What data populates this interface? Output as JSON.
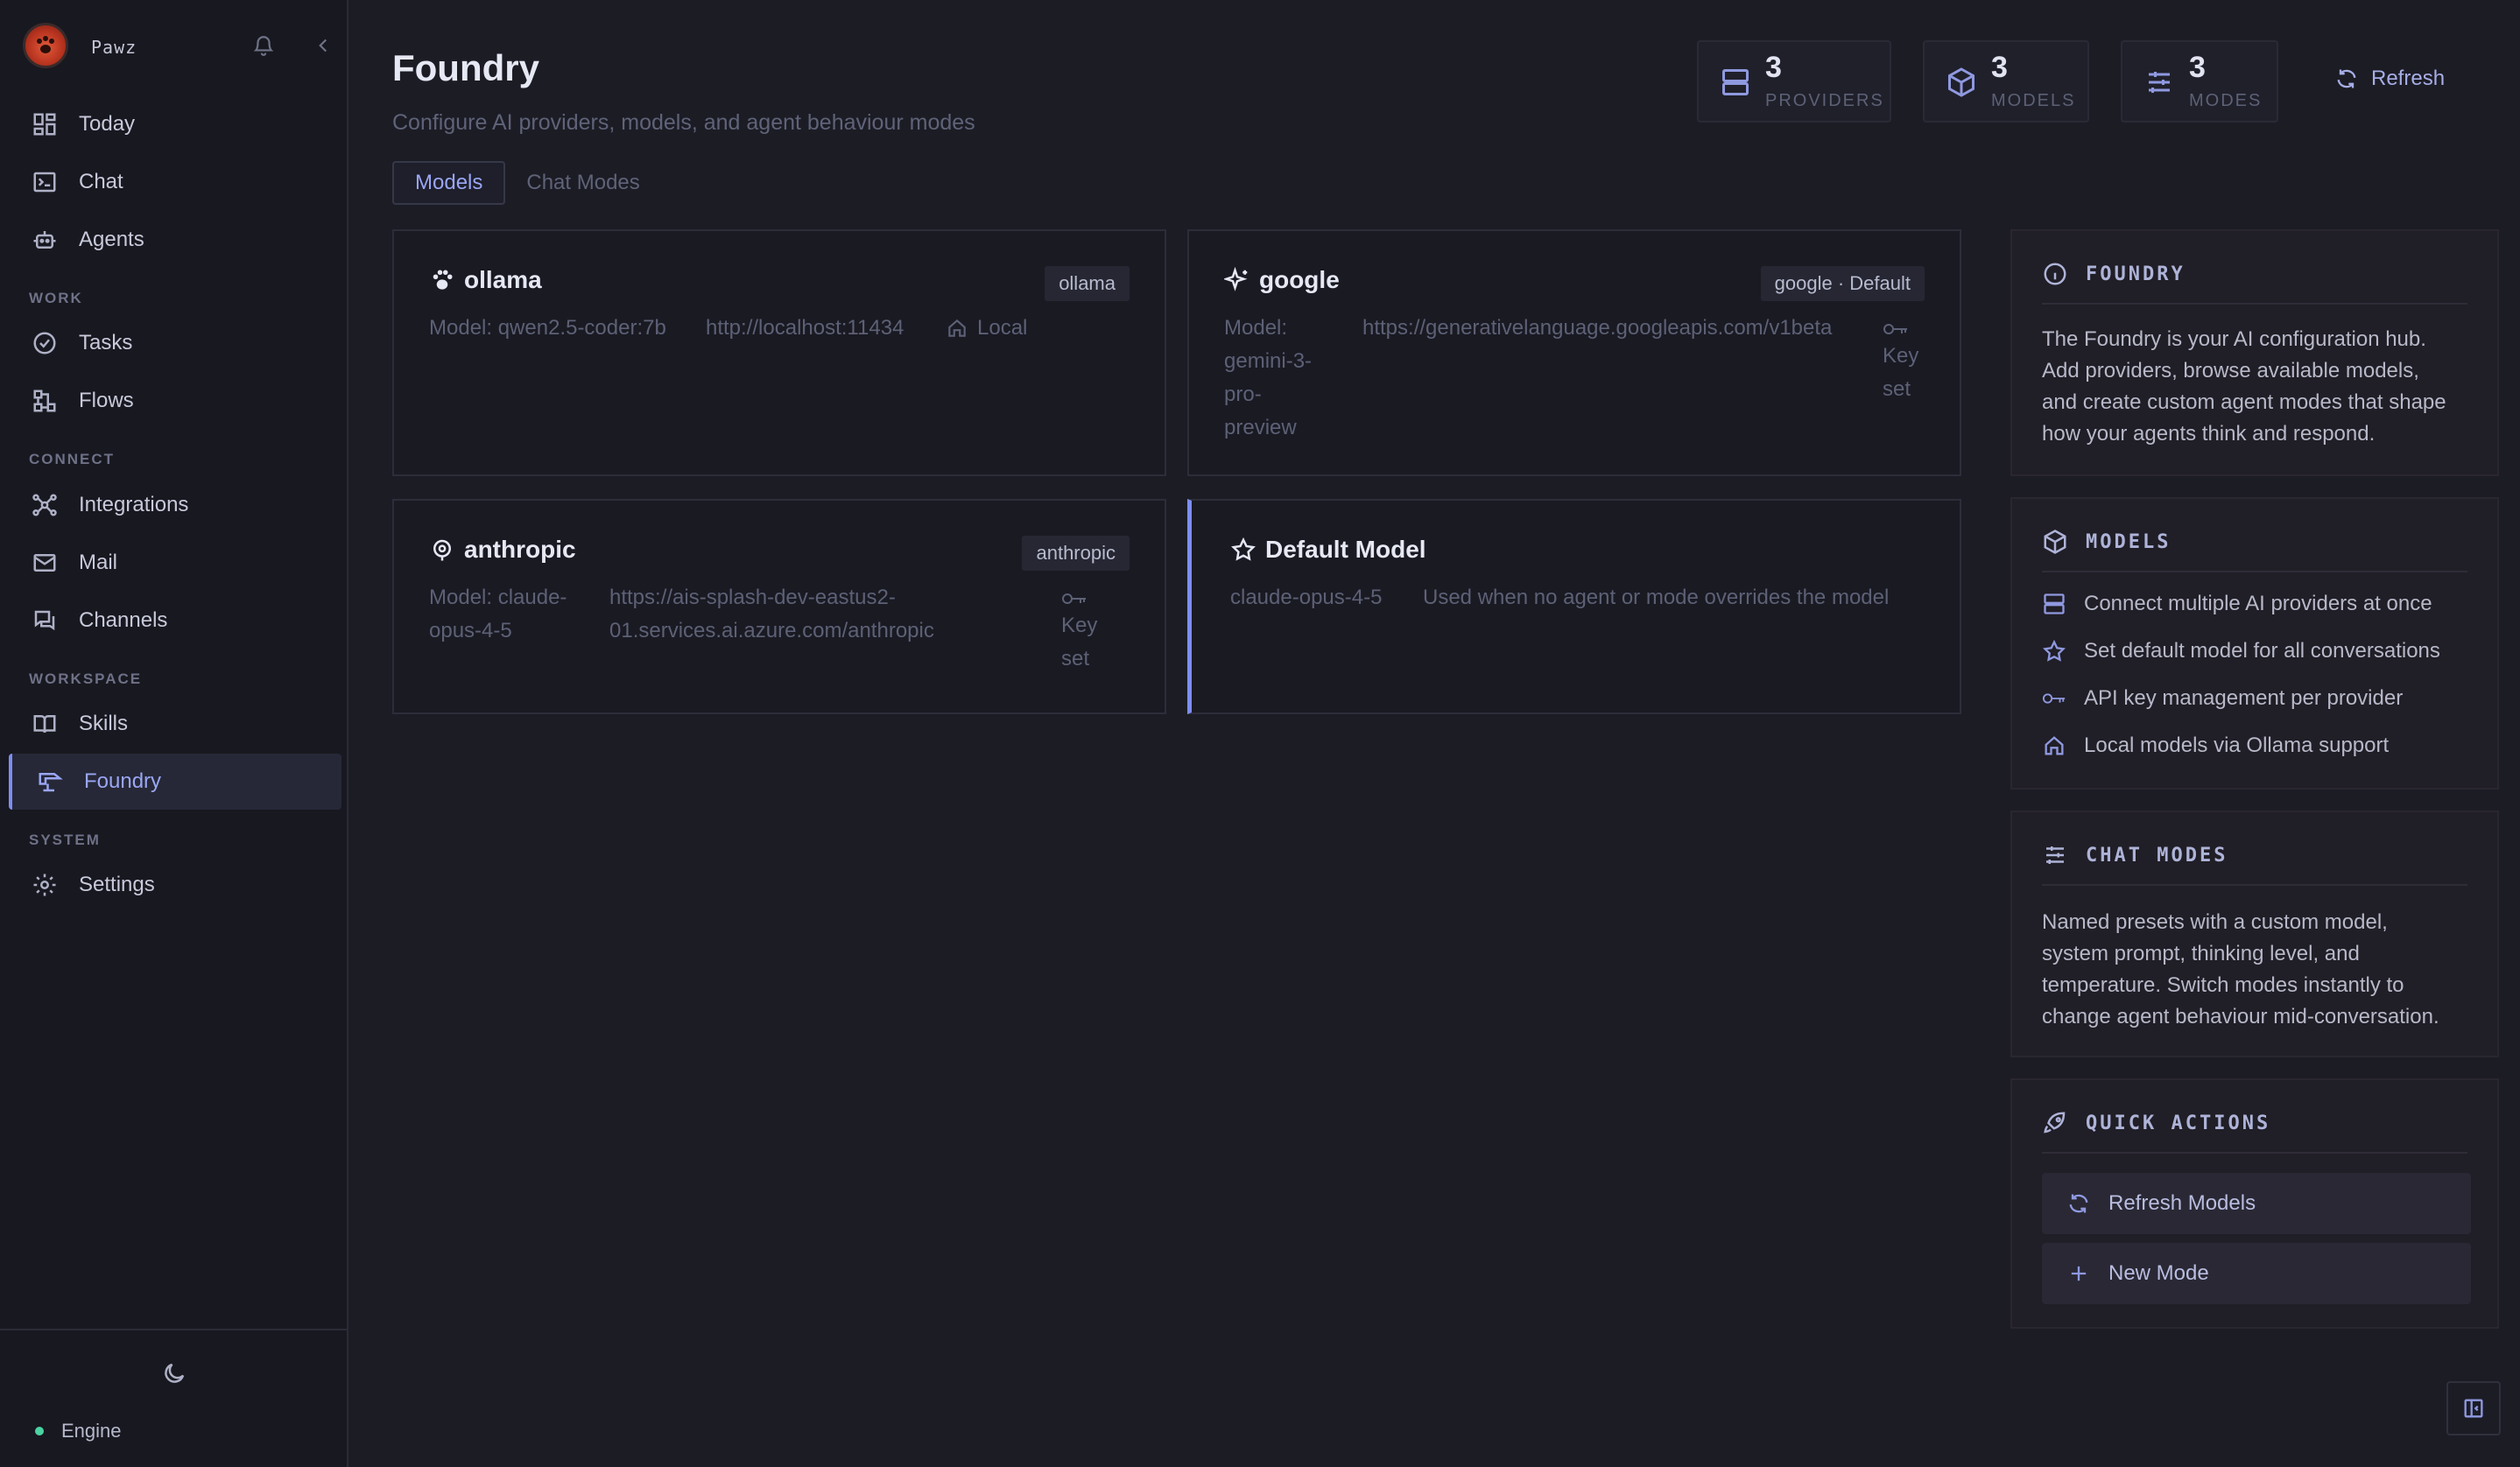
{
  "brand": {
    "name": "Pawz"
  },
  "sidebar": {
    "items_top": [
      {
        "label": "Today"
      },
      {
        "label": "Chat"
      },
      {
        "label": "Agents"
      }
    ],
    "sections": {
      "work": "WORK",
      "connect": "CONNECT",
      "workspace": "WORKSPACE",
      "system": "SYSTEM"
    },
    "work_items": [
      {
        "label": "Tasks"
      },
      {
        "label": "Flows"
      }
    ],
    "connect_items": [
      {
        "label": "Integrations"
      },
      {
        "label": "Mail"
      },
      {
        "label": "Channels"
      }
    ],
    "workspace_items": [
      {
        "label": "Skills"
      },
      {
        "label": "Foundry"
      }
    ],
    "system_items": [
      {
        "label": "Settings"
      }
    ],
    "engine_label": "Engine"
  },
  "header": {
    "title": "Foundry",
    "subtitle": "Configure AI providers, models, and agent behaviour modes",
    "stats": [
      {
        "value": "3",
        "label": "PROVIDERS",
        "icon": "server-icon"
      },
      {
        "value": "3",
        "label": "MODELS",
        "icon": "cube-icon"
      },
      {
        "value": "3",
        "label": "MODES",
        "icon": "sliders-icon"
      }
    ],
    "refresh_label": "Refresh"
  },
  "tabs": [
    {
      "label": "Models",
      "active": true
    },
    {
      "label": "Chat Modes",
      "active": false
    }
  ],
  "providers": [
    {
      "name": "ollama",
      "badge": "ollama",
      "model_line": "Model: qwen2.5-coder:7b",
      "url": "http://localhost:11434",
      "status": "Local"
    },
    {
      "name": "google",
      "badge": "google · Default",
      "model_line_1": "Model:",
      "model_line_2": "gemini-3-",
      "model_line_3": "pro-",
      "model_line_4": "preview",
      "url": "https://generativelanguage.googleapis.com/v1beta",
      "status_1": "Key",
      "status_2": "set"
    },
    {
      "name": "anthropic",
      "badge": "anthropic",
      "model_line_1": "Model: claude-",
      "model_line_2": "opus-4-5",
      "url_1": "https://ais-splash-dev-eastus2-",
      "url_2": "01.services.ai.azure.com/anthropic",
      "status_1": "Key",
      "status_2": "set"
    }
  ],
  "default_model": {
    "title": "Default Model",
    "model": "claude-opus-4-5",
    "description": "Used when no agent or mode overrides the model"
  },
  "panels": {
    "foundry": {
      "heading": "FOUNDRY",
      "lines": [
        "The Foundry is your AI configuration hub.",
        "Add providers, browse available models,",
        "and create custom agent modes that shape",
        "how your agents think and respond."
      ]
    },
    "models": {
      "heading": "MODELS",
      "features": [
        "Connect multiple AI providers at once",
        "Set default model for all conversations",
        "API key management per provider",
        "Local models via Ollama support"
      ]
    },
    "chat_modes": {
      "heading": "CHAT MODES",
      "lines": [
        "Named presets with a custom model,",
        "system prompt, thinking level, and",
        "temperature. Switch modes instantly to",
        "change agent behaviour mid-conversation."
      ]
    },
    "quick_actions": {
      "heading": "QUICK ACTIONS",
      "refresh_models": "Refresh Models",
      "new_mode": "New Mode"
    }
  },
  "colors": {
    "accent": "#7d8ef0",
    "engine_status": "#4bd3a3",
    "background": "#1c1c25"
  }
}
